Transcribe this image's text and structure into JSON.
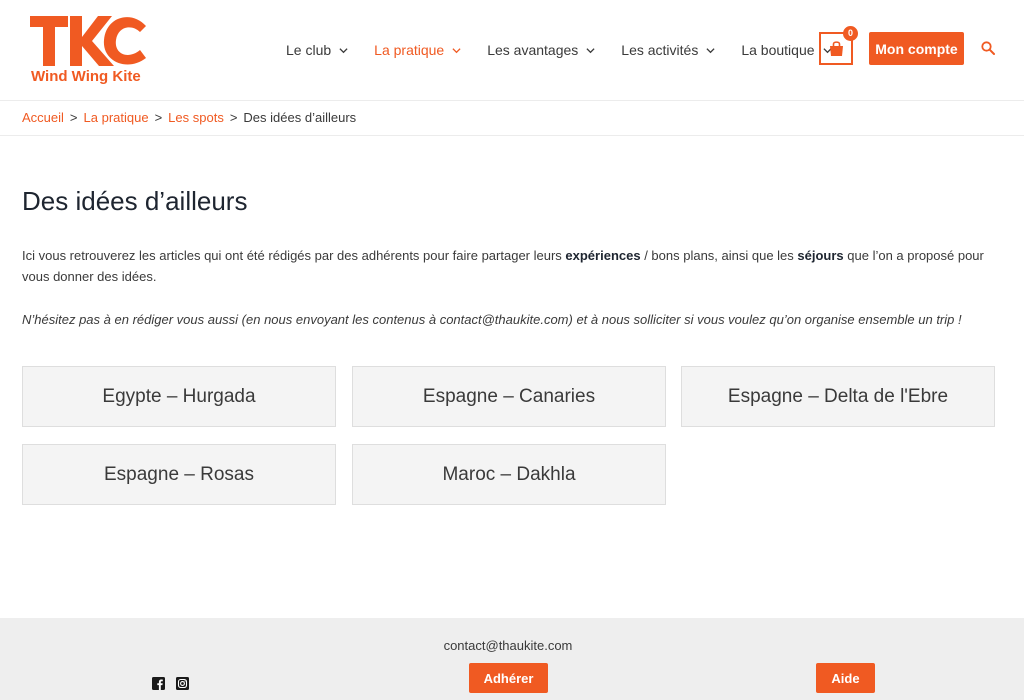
{
  "brand": {
    "logo_letters": "TKC",
    "name": "Wind Wing Kite",
    "accent_color": "#f05a22"
  },
  "nav": {
    "items": [
      {
        "label": "Le club",
        "active": false
      },
      {
        "label": "La pratique",
        "active": true
      },
      {
        "label": "Les avantages",
        "active": false
      },
      {
        "label": "Les activités",
        "active": false
      },
      {
        "label": "La boutique",
        "active": false
      }
    ],
    "cart_count": "0",
    "account_label": "Mon compte",
    "icons": {
      "cart": "shopping-bag-icon",
      "search": "search-icon",
      "dropdown": "chevron-down-icon"
    }
  },
  "breadcrumb": {
    "items": [
      "Accueil",
      "La pratique",
      "Les spots"
    ],
    "current": "Des idées d’ailleurs",
    "separator": ">"
  },
  "main": {
    "title": "Des idées d’ailleurs",
    "intro": {
      "part1": "Ici vous retrouverez les articles qui ont été rédigés par des adhérents pour faire partager leurs ",
      "bold1": "expériences",
      "part2": " / bons plans, ainsi que les ",
      "bold2": "séjours",
      "part3": " que l’on a proposé pour vous donner des idées."
    },
    "note": "N’hésitez pas à en rédiger vous aussi (en nous envoyant les contenus à contact@thaukite.com) et à nous solliciter si vous voulez qu’on organise ensemble un trip !",
    "cards": [
      "Egypte – Hurgada",
      "Espagne – Canaries",
      "Espagne – Delta de l'Ebre",
      "Espagne – Rosas",
      "Maroc – Dakhla"
    ]
  },
  "footer": {
    "email": "contact@thaukite.com",
    "join_label": "Adhérer",
    "help_label": "Aide",
    "social_icons": [
      "facebook-icon",
      "instagram-icon"
    ]
  }
}
